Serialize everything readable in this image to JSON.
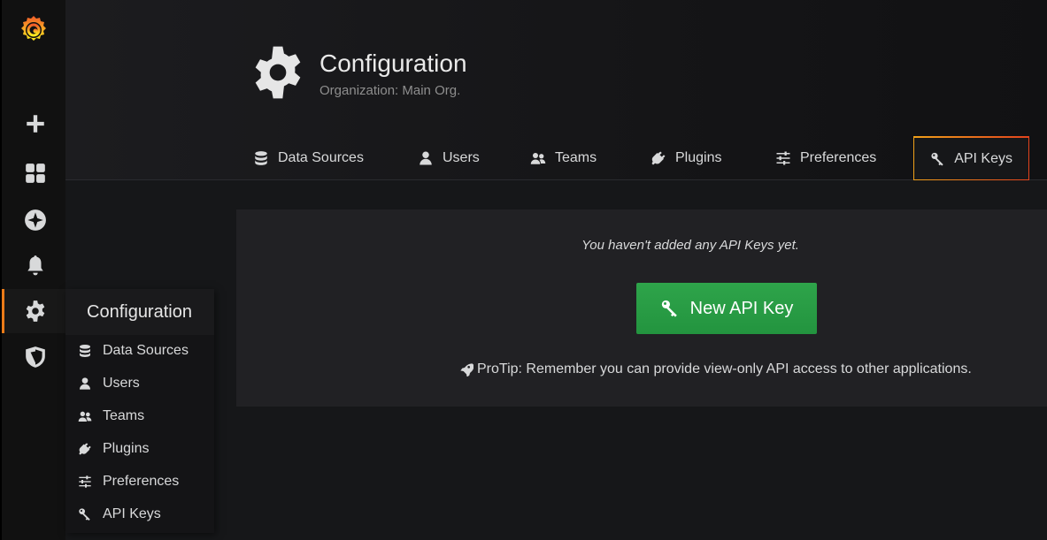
{
  "header": {
    "title": "Configuration",
    "subtitle": "Organization: Main Org."
  },
  "tabs": [
    {
      "label": "Data Sources",
      "icon": "database-icon"
    },
    {
      "label": "Users",
      "icon": "user-icon"
    },
    {
      "label": "Teams",
      "icon": "users-icon"
    },
    {
      "label": "Plugins",
      "icon": "plug-icon"
    },
    {
      "label": "Preferences",
      "icon": "sliders-icon"
    },
    {
      "label": "API Keys",
      "icon": "key-icon",
      "active": true
    }
  ],
  "sidebar": {
    "items": [
      {
        "icon": "plus-icon"
      },
      {
        "icon": "dashboards-icon"
      },
      {
        "icon": "compass-icon"
      },
      {
        "icon": "bell-icon"
      },
      {
        "icon": "gear-icon",
        "active": true
      },
      {
        "icon": "shield-icon"
      }
    ]
  },
  "flyout": {
    "title": "Configuration",
    "items": [
      {
        "label": "Data Sources",
        "icon": "database-icon"
      },
      {
        "label": "Users",
        "icon": "user-icon"
      },
      {
        "label": "Teams",
        "icon": "users-icon"
      },
      {
        "label": "Plugins",
        "icon": "plug-icon"
      },
      {
        "label": "Preferences",
        "icon": "sliders-icon"
      },
      {
        "label": "API Keys",
        "icon": "key-icon"
      }
    ]
  },
  "panel": {
    "empty_message": "You haven't added any API Keys yet.",
    "new_key_label": "New API Key",
    "protip": "ProTip: Remember you can provide view-only API access to other applications."
  },
  "colors": {
    "accent": "#eb7b18",
    "button_green": "#299c46",
    "background": "#161719"
  }
}
